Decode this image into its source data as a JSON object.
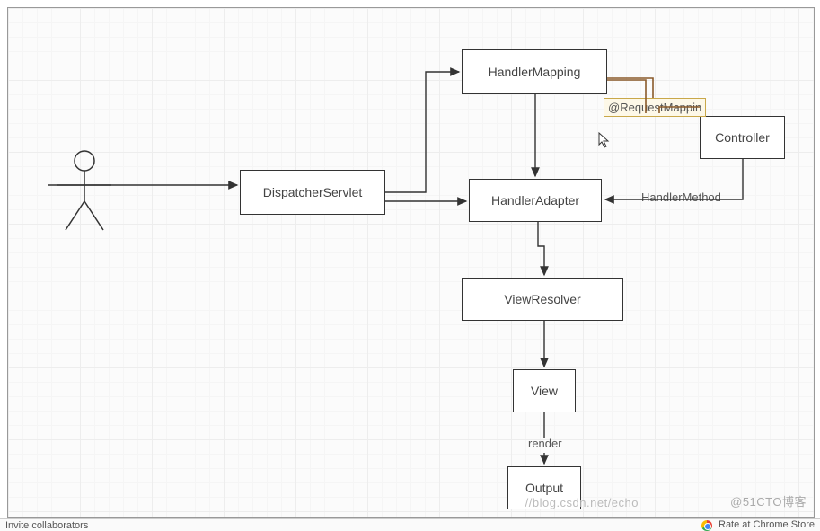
{
  "diagram": {
    "nodes": {
      "dispatcher": "DispatcherServlet",
      "handlerMapping": "HandlerMapping",
      "controller": "Controller",
      "handlerAdapter": "HandlerAdapter",
      "viewResolver": "ViewResolver",
      "view": "View",
      "output": "Output"
    },
    "annotations": {
      "requestMapping": "@RequestMappin"
    },
    "edgeLabels": {
      "handlerMethod": "HandlerMethod",
      "render": "render"
    }
  },
  "watermarks": {
    "left": "//blog.csdn.net/echo",
    "right": "@51CTO博客"
  },
  "footer": {
    "left": "          Invite collaborators",
    "right": "Rate at Chrome Store"
  }
}
